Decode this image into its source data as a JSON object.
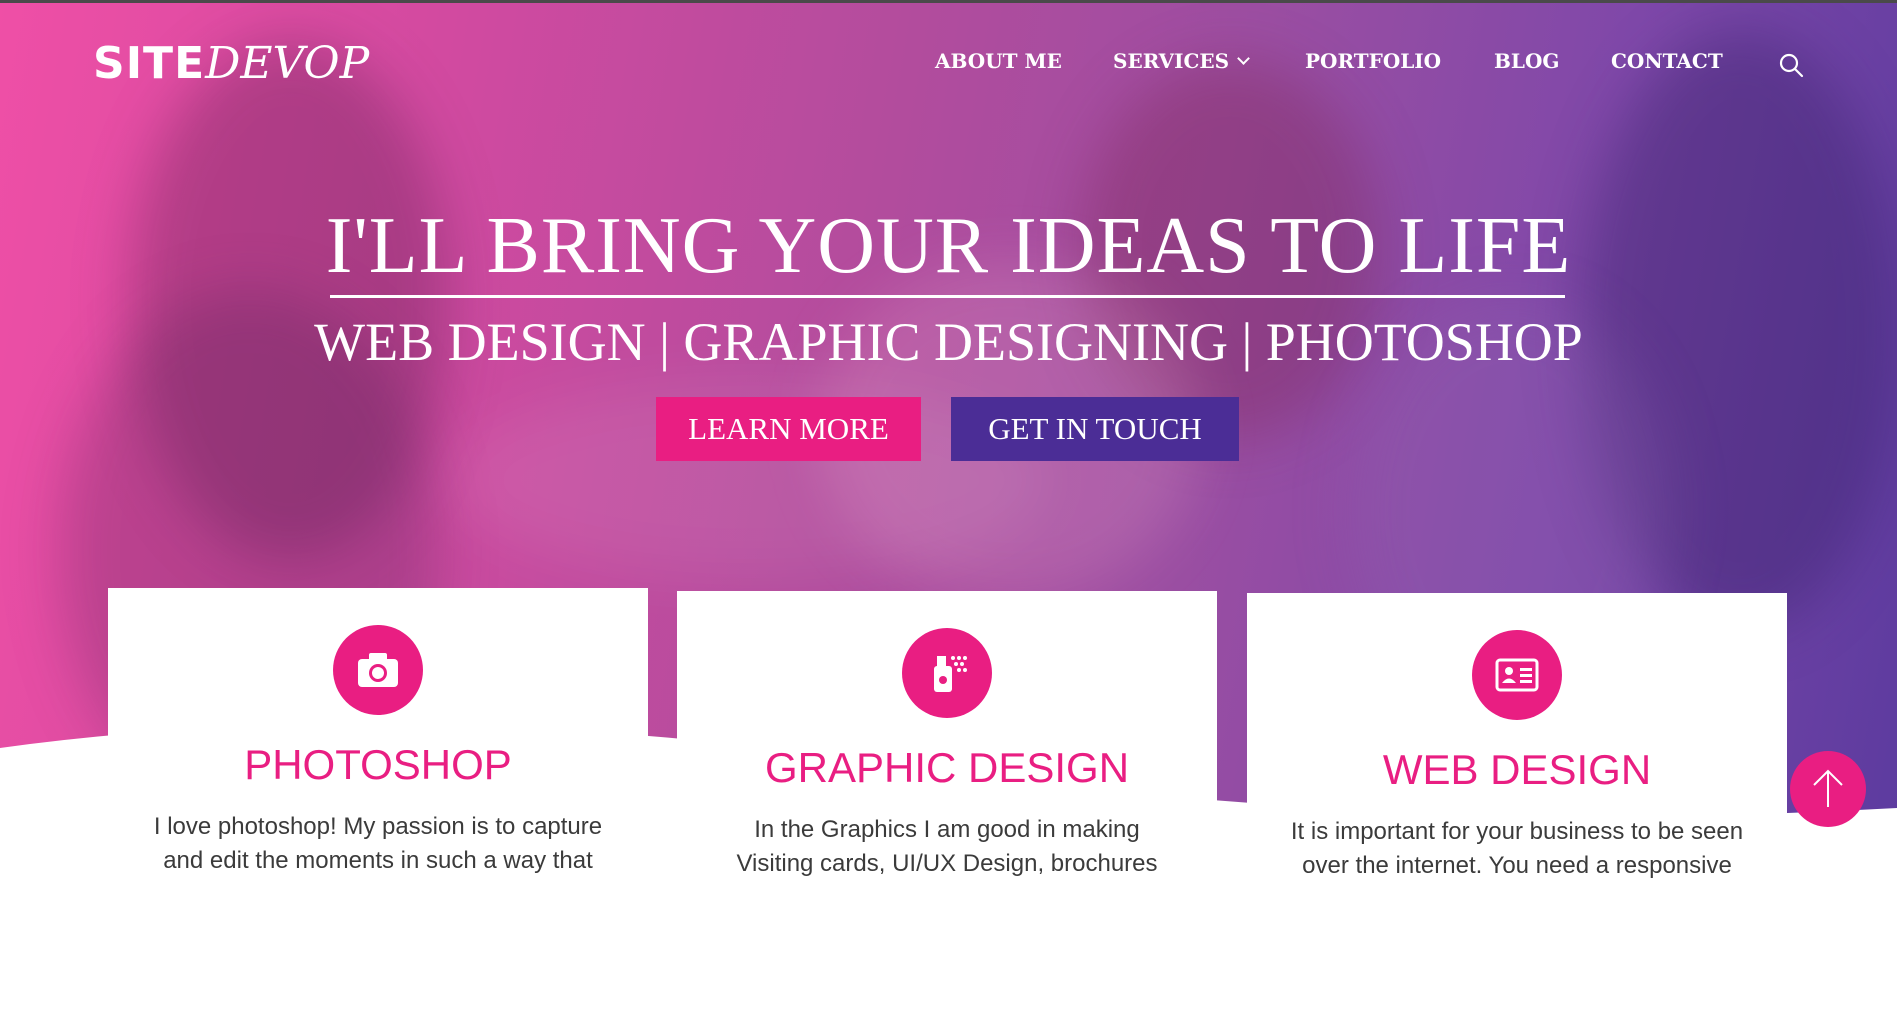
{
  "header": {
    "logo_part1": "SITE",
    "logo_part2": "DEVOP",
    "nav": [
      {
        "label": "ABOUT ME"
      },
      {
        "label": "SERVICES"
      },
      {
        "label": "PORTFOLIO"
      },
      {
        "label": "BLOG"
      },
      {
        "label": "CONTACT"
      }
    ],
    "search_icon": "search-icon"
  },
  "hero": {
    "headline": "I'LL BRING YOUR IDEAS TO LIFE",
    "subheadline": "WEB DESIGN | GRAPHIC DESIGNING | PHOTOSHOP",
    "buttons": [
      {
        "label": "LEARN MORE",
        "color": "#e91e82"
      },
      {
        "label": "GET IN TOUCH",
        "color": "#4b2d96"
      }
    ]
  },
  "cards": [
    {
      "icon": "camera-icon",
      "title": "PHOTOSHOP",
      "text_lines": [
        "I love photoshop! My passion is to capture",
        "and edit the moments in such a way that"
      ]
    },
    {
      "icon": "spray-icon",
      "title": "GRAPHIC DESIGN",
      "text_lines": [
        "In the Graphics I am good in making",
        "Visiting cards, UI/UX Design, brochures"
      ]
    },
    {
      "icon": "id-card-icon",
      "title": "WEB DESIGN",
      "text_lines": [
        "It is important for your business to be seen",
        "over the internet. You need a responsive"
      ]
    }
  ],
  "scroll_top_icon": "arrow-up-icon",
  "colors": {
    "accent": "#e91e82",
    "secondary": "#4b2d96"
  }
}
